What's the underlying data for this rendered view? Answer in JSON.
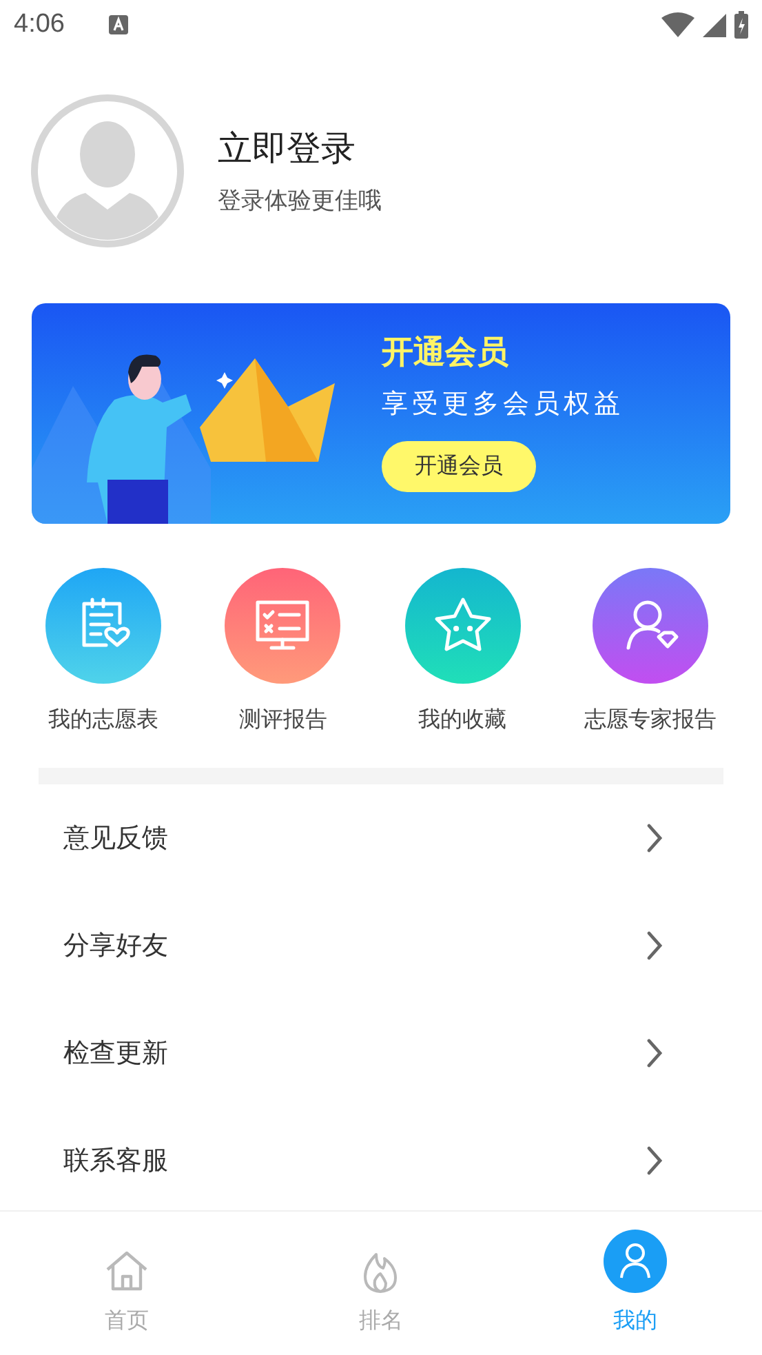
{
  "status_bar": {
    "time": "4:06"
  },
  "profile": {
    "name": "立即登录",
    "subtitle": "登录体验更佳哦"
  },
  "banner": {
    "title": "开通会员",
    "subtitle": "享受更多会员权益",
    "button": "开通会员"
  },
  "shortcuts": [
    {
      "label": "我的志愿表",
      "kind": "list"
    },
    {
      "label": "测评报告",
      "kind": "monitor"
    },
    {
      "label": "我的收藏",
      "kind": "star"
    },
    {
      "label": "志愿专家报告",
      "kind": "expert"
    }
  ],
  "menu": [
    {
      "label": "意见反馈"
    },
    {
      "label": "分享好友"
    },
    {
      "label": "检查更新"
    },
    {
      "label": "联系客服"
    }
  ],
  "tabs": [
    {
      "label": "首页",
      "kind": "home",
      "selected": false
    },
    {
      "label": "排名",
      "kind": "flame",
      "selected": false
    },
    {
      "label": "我的",
      "kind": "me",
      "selected": true
    }
  ]
}
